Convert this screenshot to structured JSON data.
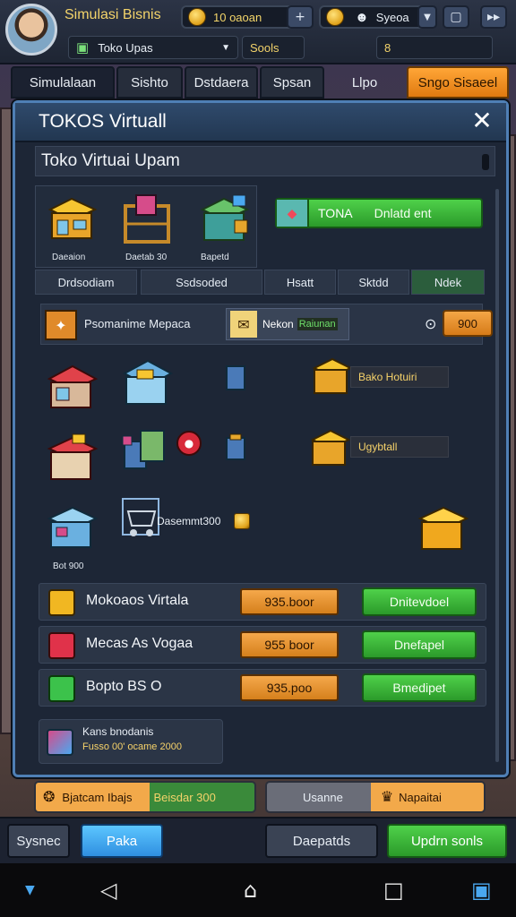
{
  "header": {
    "app_title": "Simulasi Bisnis",
    "currency_value": "10 oaoan",
    "gem_label": "Syeoa",
    "shop_label": "Toko Upas",
    "sub_label": "Sools",
    "sub_value": "8",
    "plus_symbol": "+",
    "play_symbol": "▸▸"
  },
  "nav": {
    "tabs": [
      "Simulalaan",
      "Sishto",
      "Dstdaera",
      "Spsan",
      "Llpo"
    ],
    "special": "Sngo Sisaeel"
  },
  "modal": {
    "title": "TOKOS Virtuall",
    "close": "✕",
    "subtitle": "Toko Virtuai Upam",
    "icon_labels": [
      "Daeaion",
      "Daetab 30",
      "Bapetd"
    ],
    "green_badge": "TONA",
    "green_action": "Dnlatd ent",
    "stat_tabs": [
      "Drdsodiam",
      "Ssdsoded",
      "Hsatt",
      "Sktdd",
      "Ndek"
    ],
    "market": {
      "label": "Psomanime Mepaca",
      "tag": "Nekon",
      "tag_value": "Raiunan",
      "price": "900",
      "price_icon": "⊙"
    },
    "shop_labels": [
      "Bako Hotuiri",
      "Ugybtall"
    ],
    "cart_label": "Dasemmt300",
    "bottom_icon_label": "Bot 900",
    "rows": [
      {
        "name": "Mokoaos Virtala",
        "price": "935.boor",
        "button": "Dnitevdoel",
        "color": "#f1b722"
      },
      {
        "name": "Mecas As Vogaa",
        "price": "955 boor",
        "button": "Dnefapel",
        "color": "#e0324a"
      },
      {
        "name": "Bopto BS O",
        "price": "935.poo",
        "button": "Bmedipet",
        "color": "#3cc24b"
      }
    ],
    "info": {
      "line1": "Kans bnodanis",
      "line2": "Fusso 00' ocame 2000"
    }
  },
  "strip": {
    "left_label": "Bjatcam Ibajs",
    "left_value": "Beisdar 300",
    "mid_label": "Usanne",
    "right_label": "Napaitai"
  },
  "bottom": {
    "b1": "Sysnec",
    "b2": "Paka",
    "b3": "Daepatds",
    "b4": "Updrn sonls"
  },
  "colors": {
    "accent_orange": "#f39a2e",
    "accent_green": "#3cbf3a",
    "accent_blue": "#4aa8f0",
    "modal_border": "#4f7fb5"
  }
}
